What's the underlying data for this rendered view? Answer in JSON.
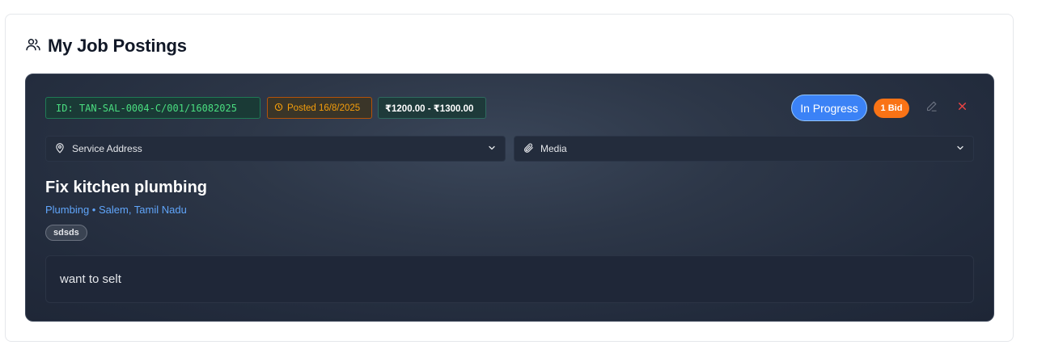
{
  "section": {
    "title": "My Job Postings",
    "icon": "users-icon"
  },
  "job": {
    "id_label": "ID: TAN-SAL-0004-C/001/16082025",
    "posted_label": "Posted 16/8/2025",
    "price_label": "₹1200.00 - ₹1300.00",
    "status_label": "In Progress",
    "bids_label": "1 Bid",
    "service_address_label": "Service Address",
    "media_label": "Media",
    "title": "Fix kitchen plumbing",
    "meta": "Plumbing • Salem, Tamil Nadu",
    "skill_tag": "sdsds",
    "description": "want to selt"
  },
  "colors": {
    "card_bg": "#2d3748",
    "status_blue": "#3b82f6",
    "bid_orange": "#f97316",
    "id_green": "#4ade80",
    "date_amber": "#f59e0b",
    "meta_blue": "#60a5fa",
    "close_red": "#ef4444"
  },
  "icons": {
    "date": "clock-icon",
    "address": "map-pin-icon",
    "media": "paperclip-icon",
    "edit": "pencil-icon",
    "close": "close-icon",
    "expand": "chevron-down-icon"
  }
}
